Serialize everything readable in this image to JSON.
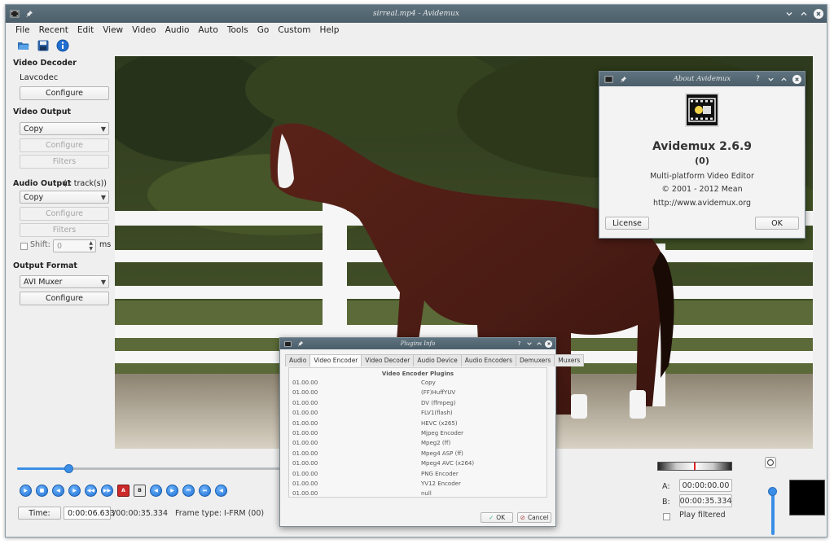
{
  "window": {
    "title": "sirreal.mp4 - Avidemux"
  },
  "menu": [
    "File",
    "Recent",
    "Edit",
    "View",
    "Video",
    "Audio",
    "Auto",
    "Tools",
    "Go",
    "Custom",
    "Help"
  ],
  "toolbar_icons": [
    "open-file-icon",
    "save-file-icon",
    "info-icon"
  ],
  "video_decoder": {
    "title": "Video Decoder",
    "decoder": "Lavcodec",
    "configure_label": "Configure"
  },
  "video_output": {
    "title": "Video Output",
    "codec": "Copy",
    "configure_label": "Configure",
    "filters_label": "Filters"
  },
  "audio_output": {
    "title": "Audio Output",
    "tracks": "(1 track(s))",
    "codec": "Copy",
    "configure_label": "Configure",
    "filters_label": "Filters",
    "shift_label": "Shift:",
    "shift_value": "0",
    "shift_unit": "ms"
  },
  "output_format": {
    "title": "Output Format",
    "muxer": "AVI Muxer",
    "configure_label": "Configure"
  },
  "about_dialog": {
    "title": "About Avidemux",
    "app_name": "Avidemux 2.6.9",
    "build": "(0)",
    "tagline": "Multi-platform Video Editor",
    "copyright": "© 2001 - 2012  Mean",
    "url": "http://www.avidemux.org",
    "license_label": "License",
    "ok_label": "OK"
  },
  "plugins_dialog": {
    "title": "Plugins Info",
    "tabs": [
      "Audio",
      "Video Encoder",
      "Video Decoder",
      "Audio Device",
      "Audio Encoders",
      "Demuxers",
      "Muxers"
    ],
    "active_tab": "Video Encoder",
    "table_title": "Video Encoder Plugins",
    "rows": [
      {
        "version": "01.00.00",
        "name": "Copy"
      },
      {
        "version": "01.00.00",
        "name": "(FF)HuffYUV"
      },
      {
        "version": "01.00.00",
        "name": "DV (ffmpeg)"
      },
      {
        "version": "01.00.00",
        "name": "FLV1(flash)"
      },
      {
        "version": "01.00.00",
        "name": "HEVC (x265)"
      },
      {
        "version": "01.00.00",
        "name": "Mjpeg Encoder"
      },
      {
        "version": "01.00.00",
        "name": "Mpeg2 (ff)"
      },
      {
        "version": "01.00.00",
        "name": "Mpeg4 ASP (ff)"
      },
      {
        "version": "01.00.00",
        "name": "Mpeg4 AVC (x264)"
      },
      {
        "version": "01.00.00",
        "name": "PNG Encoder"
      },
      {
        "version": "01.00.00",
        "name": "YV12 Encoder"
      },
      {
        "version": "01.00.00",
        "name": "null"
      }
    ],
    "ok_label": "OK",
    "cancel_label": "Cancel"
  },
  "playback": {
    "position_fraction": 0.19,
    "time_label": "Time:",
    "current_time": "0:00:06.633",
    "total_time": "/00:00:35.334",
    "frame_type": "Frame type:  I-FRM (00)",
    "marker_a_label": "A:",
    "marker_a": "00:00:00.00",
    "marker_b_label": "B:",
    "marker_b": "00:00:35.334",
    "play_filtered_label": "Play filtered",
    "volume_fraction": 1.0
  },
  "control_icons": [
    "play-icon",
    "stop-icon",
    "previous-frame-icon",
    "next-frame-icon",
    "previous-keyframe-icon",
    "next-keyframe-icon",
    "set-marker-a-icon",
    "set-marker-b-icon",
    "goto-marker-a-icon",
    "goto-marker-b-icon",
    "first-frame-icon",
    "last-frame-icon",
    "previous-black-frame-icon"
  ],
  "colors": {
    "titlebar": "#4b5e6a",
    "accent_blue": "#3a8ee6",
    "window_bg": "#efefef"
  }
}
